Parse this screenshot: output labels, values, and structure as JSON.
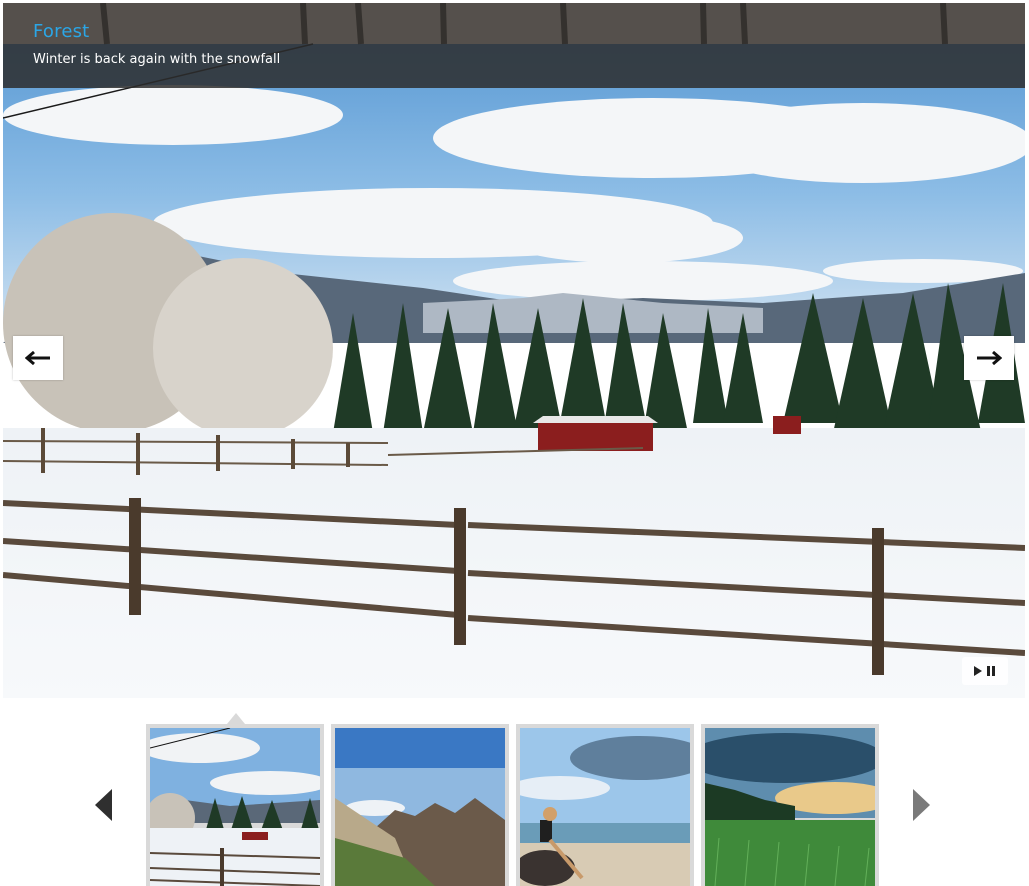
{
  "slide": {
    "title": "Forest",
    "caption": "Winter is back again with the snowfall",
    "prev_icon": "left-arrow-icon",
    "next_icon": "right-arrow-icon",
    "playpause_icons": [
      "play-icon",
      "pause-icon"
    ]
  },
  "thumbnails": {
    "prev_icon": "triangle-left-icon",
    "next_icon": "triangle-right-icon",
    "active_index": 0,
    "items": [
      "snowy-farm",
      "mountain-valley",
      "woman-on-beach",
      "green-field"
    ]
  },
  "colors": {
    "title_blue": "#2ba6e6",
    "caption_bar": "#2d2d2d",
    "thumb_border": "#d9d9d9"
  }
}
